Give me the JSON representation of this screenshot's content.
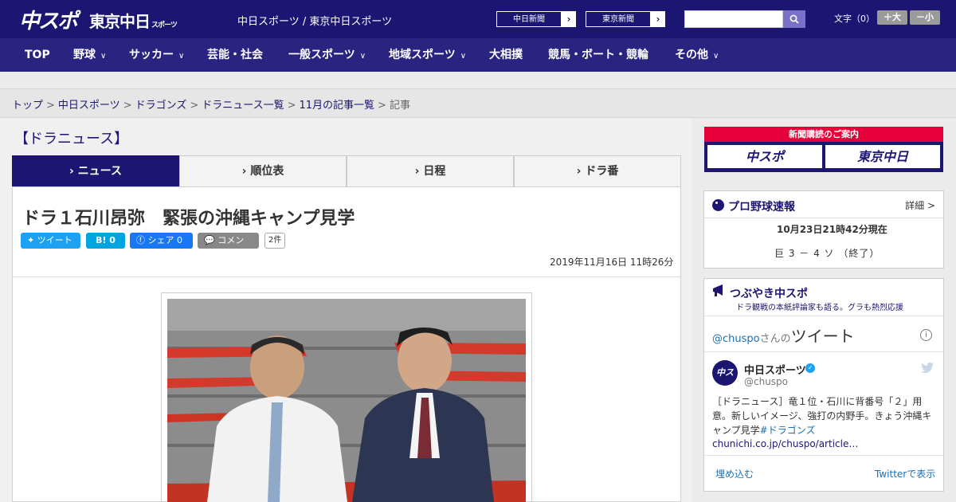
{
  "header": {
    "logo_main": "中スポ",
    "logo_tokyo": "東京中日",
    "logo_tokyo_small": "スポーツ",
    "site_text": "中日スポーツ / 東京中日スポーツ",
    "paper_buttons": [
      "中日新聞",
      "東京新聞"
    ],
    "fontsize_label": "文字（0）",
    "fontsize_plus": "＋大",
    "fontsize_minus": "－小"
  },
  "nav": {
    "items": [
      {
        "label": "TOP",
        "has_dropdown": false
      },
      {
        "label": "野球",
        "has_dropdown": true
      },
      {
        "label": "サッカー",
        "has_dropdown": true
      },
      {
        "label": "芸能・社会",
        "has_dropdown": false
      },
      {
        "label": "一般スポーツ",
        "has_dropdown": true
      },
      {
        "label": "地域スポーツ",
        "has_dropdown": true
      },
      {
        "label": "大相撲",
        "has_dropdown": false
      },
      {
        "label": "競馬・ボート・競輪",
        "has_dropdown": false
      },
      {
        "label": "その他",
        "has_dropdown": true
      }
    ]
  },
  "breadcrumb": {
    "items": [
      "トップ",
      "中日スポーツ",
      "ドラゴンズ",
      "ドラニュース一覧",
      "11月の記事一覧"
    ],
    "current": "記事"
  },
  "section": {
    "title": "【ドラニュース】"
  },
  "tabs": [
    {
      "label": "ニュース",
      "active": true
    },
    {
      "label": "順位表",
      "active": false
    },
    {
      "label": "日程",
      "active": false
    },
    {
      "label": "ドラ番",
      "active": false
    }
  ],
  "article": {
    "title": "ドラ１石川昂弥　緊張の沖縄キャンプ見学",
    "share": {
      "tweet": "ツイート",
      "hatena": "B! 0",
      "facebook": "シェア 0",
      "comment": "コメント",
      "comment_count": "2件"
    },
    "date": "2019年11月16日 11時26分"
  },
  "sidebar": {
    "ad": {
      "title": "新聞購読のご案内",
      "btn1": "中スポ",
      "btn2": "東京中日"
    },
    "baseball": {
      "title": "プロ野球速報",
      "more": "詳細 >",
      "time": "10月23日21時42分現在",
      "score": "巨 3 － 4 ソ （終了）"
    },
    "twitter": {
      "title": "つぶやき中スポ",
      "subtitle": "ドラ観戦の本紙評論家も語る。グラも熱烈応援",
      "handle_head": "@chuspo",
      "handle_suffix": "さんの",
      "tweets_word": "ツイート",
      "user_name": "中日スポーツ",
      "user_handle": "@chuspo",
      "avatar": "中スポ",
      "body": "［ドラニュース］竜１位・石川に背番号「２」用意。新しいイメージ、強打の内野手。きょう沖縄キャンプ見学",
      "hashtag": "#ドラゴンズ",
      "link": "chunichi.co.jp/chuspo/article…",
      "embed": "埋め込む",
      "view": "Twitterで表示"
    }
  },
  "colors": {
    "brand": "#1c1672",
    "nav": "#2a2480",
    "accent_red": "#e60039",
    "twitter": "#1da1f2",
    "facebook": "#3b5998",
    "hatena": "#00a4de"
  }
}
